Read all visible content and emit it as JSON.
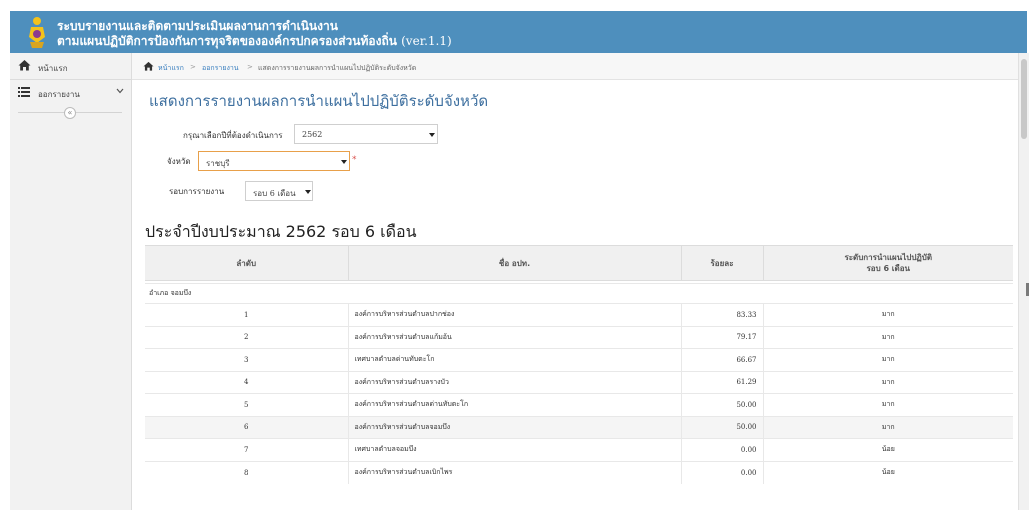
{
  "header": {
    "title_line1": "ระบบรายงานและติดตามประเมินผลงานการดำเนินงาน",
    "title_line2": "ตามแผนปฏิบัติการป้องกันการทุจริตขององค์กรปกครองส่วนท้องถิ่น",
    "version": "(ver.1.1)",
    "logo_icon": "emblem-icon",
    "color": "#4e8fbd"
  },
  "sidebar": {
    "home_label": "หน้าแรก",
    "report_label": "ออกรายงาน",
    "collapse_label": "«"
  },
  "breadcrumb": {
    "home": "หน้าแรก",
    "reports": "ออกรายงาน",
    "current": "แสดงการรายงานผลการนำแผนไปปฏิบัติระดับจังหวัด",
    "separator": ">"
  },
  "page": {
    "title": "แสดงการรายงานผลการนำแผนไปปฏิบัติระดับจังหวัด"
  },
  "filters": {
    "year_label": "กรุณาเลือกปีที่ต้องดำเนินการ",
    "year_value": "2562",
    "province_label": "จังหวัด",
    "province_value": "ราชบุรี",
    "required_mark": "*",
    "round_label": "รอบการรายงาน",
    "round_value": "รอบ 6 เดือน"
  },
  "report": {
    "section_title": "ประจำปีงบประมาณ 2562 รอบ 6 เดือน",
    "columns": {
      "order": "ลำดับ",
      "name": "ชื่อ อปท.",
      "percent": "ร้อยละ",
      "level_line1": "ระดับการนำแผนไปปฏิบัติ",
      "level_line2": "รอบ 6 เดือน"
    },
    "group": "อำเภอ จอมบึง",
    "rows": [
      {
        "no": "1",
        "name": "องค์การบริหารส่วนตำบลปากช่อง",
        "percent": "83.33",
        "level": "มาก"
      },
      {
        "no": "2",
        "name": "องค์การบริหารส่วนตำบลแก้มอ้น",
        "percent": "79.17",
        "level": "มาก"
      },
      {
        "no": "3",
        "name": "เทศบาลตำบลด่านทับตะโก",
        "percent": "66.67",
        "level": "มาก"
      },
      {
        "no": "4",
        "name": "องค์การบริหารส่วนตำบลรางบัว",
        "percent": "61.29",
        "level": "มาก"
      },
      {
        "no": "5",
        "name": "องค์การบริหารส่วนตำบลด่านทับตะโก",
        "percent": "50.00",
        "level": "มาก"
      },
      {
        "no": "6",
        "name": "องค์การบริหารส่วนตำบลจอมบึง",
        "percent": "50.00",
        "level": "มาก"
      },
      {
        "no": "7",
        "name": "เทศบาลตำบลจอมบึง",
        "percent": "0.00",
        "level": "น้อย"
      },
      {
        "no": "8",
        "name": "องค์การบริหารส่วนตำบลเบิกไพร",
        "percent": "0.00",
        "level": "น้อย"
      }
    ]
  }
}
